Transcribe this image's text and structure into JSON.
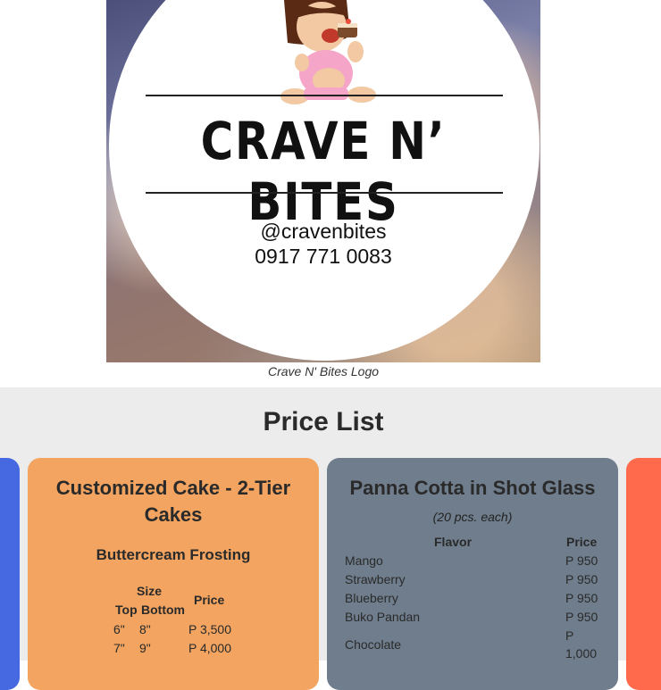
{
  "logo": {
    "brand_name": "CRAVE N’ BITES",
    "handle": "@cravenbites",
    "phone": "0917 771 0083",
    "caption": "Crave N' Bites Logo"
  },
  "price_list": {
    "title": "Price List",
    "cake_card": {
      "title": "Customized Cake - 2-Tier Cakes",
      "subtitle": "Buttercream Frosting",
      "headers": {
        "size": "Size",
        "top": "Top",
        "bottom": "Bottom",
        "price": "Price"
      },
      "rows": [
        {
          "top": "6\"",
          "bottom": "8\"",
          "price": "P 3,500"
        },
        {
          "top": "7\"",
          "bottom": "9\"",
          "price": "P 4,000"
        }
      ]
    },
    "panna_card": {
      "title": "Panna Cotta in Shot Glass",
      "note": "(20 pcs. each)",
      "headers": {
        "flavor": "Flavor",
        "price": "Price"
      },
      "rows": [
        {
          "flavor": "Mango",
          "price": "P 950"
        },
        {
          "flavor": "Strawberry",
          "price": "P 950"
        },
        {
          "flavor": "Blueberry",
          "price": "P 950"
        },
        {
          "flavor": "Buko Pandan",
          "price": "P 950"
        },
        {
          "flavor": "Chocolate",
          "price_line1": "P",
          "price_line2": "1,000"
        }
      ]
    }
  },
  "colors": {
    "cake_card": "#f2a460",
    "panna_card": "#6f7d8c",
    "left_card": "#4668e0",
    "right_card": "#ff6a4d",
    "section_bg": "#ececec"
  }
}
